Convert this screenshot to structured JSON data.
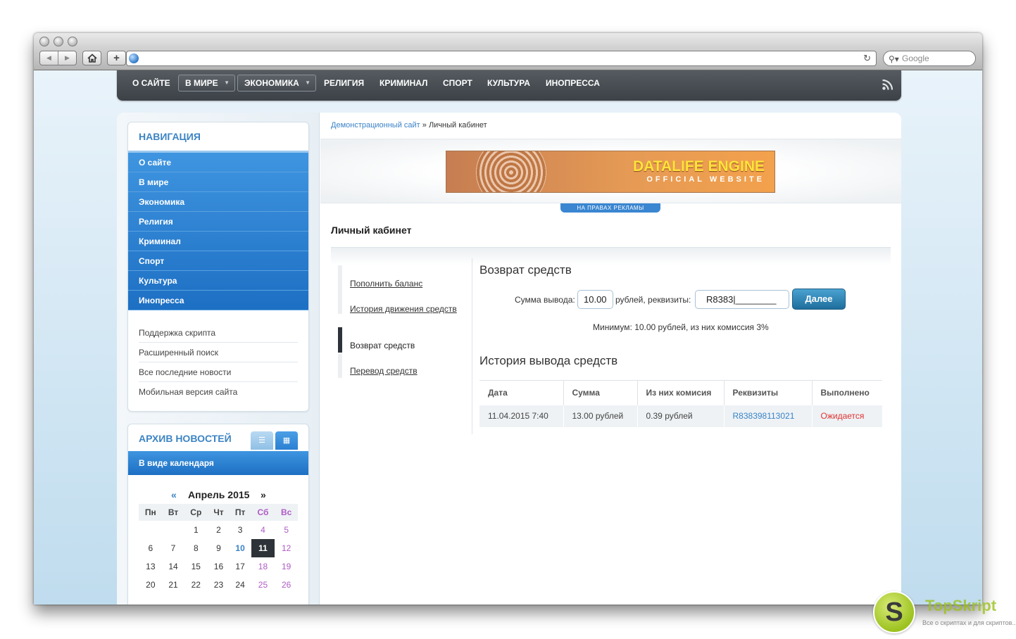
{
  "browser": {
    "search_placeholder": "Google"
  },
  "topnav": {
    "items": [
      "О САЙТЕ",
      "В МИРЕ",
      "ЭКОНОМИКА",
      "РЕЛИГИЯ",
      "КРИМИНАЛ",
      "СПОРТ",
      "КУЛЬТУРА",
      "ИНОПРЕССА"
    ]
  },
  "sidebar": {
    "nav_title": "НАВИГАЦИЯ",
    "nav_items": [
      "О сайте",
      "В мире",
      "Экономика",
      "Религия",
      "Криминал",
      "Спорт",
      "Культура",
      "Инопресса"
    ],
    "sub_items": [
      "Поддержка скрипта",
      "Расширенный поиск",
      "Все последние новости",
      "Мобильная версия сайта"
    ],
    "archive_title": "АРХИВ НОВОСТЕЙ",
    "calendar_label": "В виде календаря",
    "calendar": {
      "prev": "«",
      "next": "»",
      "month": "Апрель 2015",
      "weekdays": [
        "Пн",
        "Вт",
        "Ср",
        "Чт",
        "Пт",
        "Сб",
        "Вс"
      ],
      "weeks": [
        [
          "",
          "",
          "1",
          "2",
          "3",
          "4",
          "5"
        ],
        [
          "6",
          "7",
          "8",
          "9",
          "10",
          "11",
          "12"
        ],
        [
          "13",
          "14",
          "15",
          "16",
          "17",
          "18",
          "19"
        ],
        [
          "20",
          "21",
          "22",
          "23",
          "24",
          "25",
          "26"
        ]
      ],
      "today": "11",
      "linked": [
        "10"
      ]
    }
  },
  "breadcrumb": {
    "home": "Демонстрационный сайт",
    "separator": " » ",
    "current": "Личный кабинет"
  },
  "banner": {
    "line1": "DATALIFE ENGINE",
    "line2": "OFFICIAL WEBSITE",
    "ad_label": "НА ПРАВАХ РЕКЛАМЫ"
  },
  "page_title": "Личный кабинет",
  "cabinet_menu": {
    "items": [
      "Пополнить баланс",
      "История движения средств",
      "Возврат средств",
      "Перевод средств"
    ],
    "active": "Возврат средств"
  },
  "withdraw": {
    "title": "Возврат средств",
    "amount_label": "Сумма вывода:",
    "amount_value": "10.00",
    "currency_label": "рублей, реквизиты:",
    "requisites_value": "R8383|________",
    "submit_label": "Далее",
    "note": "Минимум: 10.00 рублей, из них комиссия 3%"
  },
  "history": {
    "title": "История вывода средств",
    "columns": [
      "Дата",
      "Сумма",
      "Из них комисия",
      "Реквизиты",
      "Выполнено"
    ],
    "rows": [
      [
        "11.04.2015 7:40",
        "13.00 рублей",
        "0.39 рублей",
        "R838398113021",
        "Ожидается"
      ]
    ]
  },
  "watermark": {
    "letter": "S",
    "title": "TopSkript",
    "subtitle": "Все о скриптах и для скриптов..."
  },
  "colors": {
    "accent_blue": "#2a80d2",
    "nav_dark": "#444a4f",
    "status_pending": "#e03232"
  }
}
